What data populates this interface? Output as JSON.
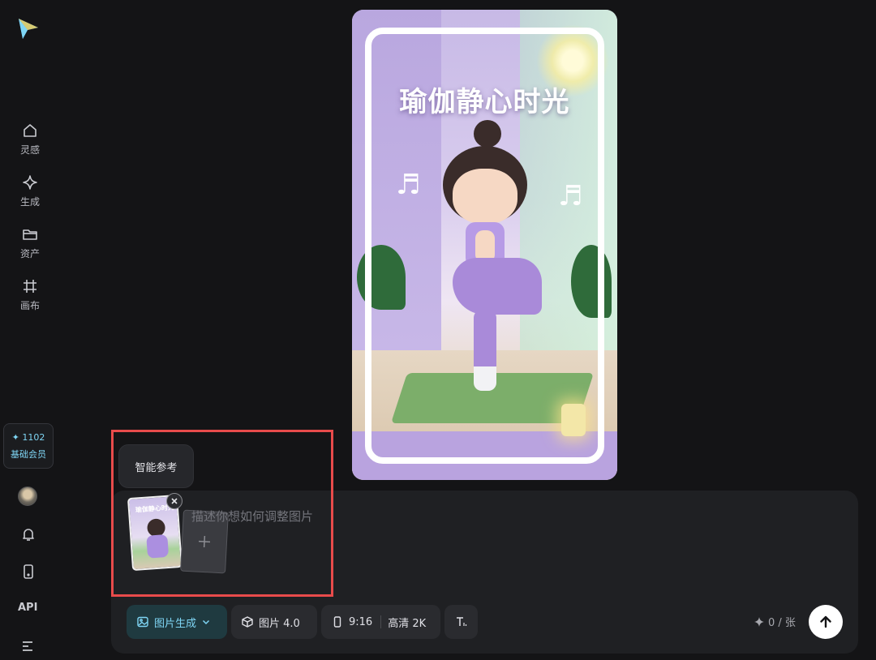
{
  "sidebar": {
    "nav": [
      {
        "label": "灵感",
        "icon": "home-icon"
      },
      {
        "label": "生成",
        "icon": "diamond-icon"
      },
      {
        "label": "资产",
        "icon": "folder-icon"
      },
      {
        "label": "画布",
        "icon": "canvas-grid-icon"
      }
    ],
    "member": {
      "points": "1102",
      "level": "基础会员"
    },
    "api_label": "API"
  },
  "preview": {
    "title": "瑜伽静心时光",
    "note_symbol": "♬"
  },
  "popover": {
    "label": "智能参考"
  },
  "composer": {
    "reference_thumb_title": "瑜伽静心时光",
    "prompt_placeholder": "描述你想如何调整图片",
    "prompt_value": "",
    "mode_label": "图片生成",
    "model_label": "图片 4.0",
    "ratio_label": "9:16",
    "quality_label": "高清 2K",
    "credits": "0 / 张"
  },
  "colors": {
    "accent": "#7fd6f5",
    "background": "#141416",
    "panel": "#1f2023",
    "highlight": "#e84b4b"
  }
}
